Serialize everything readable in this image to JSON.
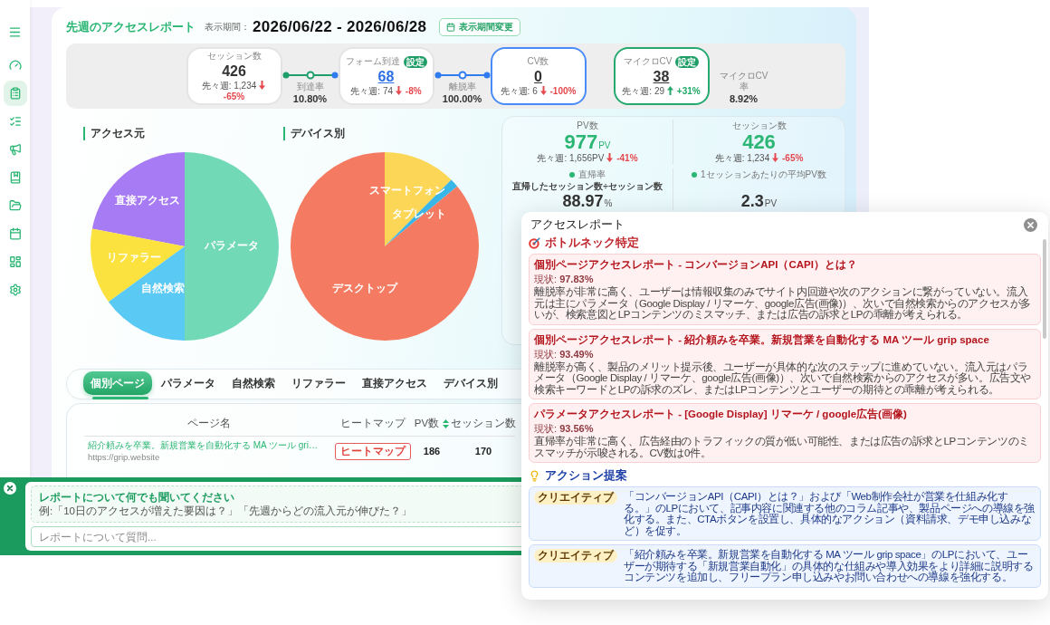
{
  "sidebar": {
    "items": [
      {
        "kind": "gauge",
        "selected": false
      },
      {
        "kind": "clipboard",
        "selected": true
      },
      {
        "kind": "checklist",
        "selected": false
      },
      {
        "kind": "megaphone",
        "selected": false
      },
      {
        "kind": "book",
        "selected": false
      },
      {
        "kind": "folder",
        "selected": false
      },
      {
        "kind": "calendar",
        "selected": false
      },
      {
        "kind": "layout",
        "selected": false
      },
      {
        "kind": "settings",
        "selected": false
      }
    ]
  },
  "header": {
    "title": "先週のアクセスレポート",
    "period_label": "表示期間：",
    "period": "2026/06/22 - 2026/06/28",
    "change_button": "表示期間変更"
  },
  "funnel": {
    "items": [
      {
        "kind": "card",
        "label": "セッション数",
        "color": "#e4e4e4",
        "value": {
          "text": "426",
          "underlined": false,
          "color": "#333333"
        },
        "comparison": {
          "kind": "down",
          "previous": "先々週: 1,234",
          "change": "-65%",
          "color": "#e5484d"
        }
      },
      {
        "kind": "connector",
        "label": "到達率",
        "value": "10.80%",
        "color": "#1e9e6a",
        "end_dot": {
          "color": "#2f7bf0"
        }
      },
      {
        "kind": "card",
        "label": "フォーム到達",
        "badge": "設定",
        "color": "#e4e4e4",
        "value": {
          "text": "68",
          "underlined": true,
          "color": "#2f6fe6"
        },
        "comparison": {
          "kind": "down",
          "previous": "先々週: 74",
          "change": "-8%",
          "color": "#e5484d"
        }
      },
      {
        "kind": "connector",
        "label": "離脱率",
        "value": "100.00%",
        "color": "#2f7bf0",
        "end_dot": {
          "color": "#2f7bf0"
        }
      },
      {
        "kind": "card",
        "label": "CV数",
        "color": "#4a8cf7",
        "value": {
          "text": "0",
          "underlined": true,
          "color": "#333333"
        },
        "comparison": {
          "kind": "down",
          "previous": "先々週: 6",
          "change": "-100%",
          "color": "#e5484d"
        }
      },
      {
        "kind": "card",
        "label": "マイクロCV",
        "badge": "設定",
        "color": "#26a96f",
        "value": {
          "text": "38",
          "underlined": true,
          "color": "#333333"
        },
        "comparison": {
          "kind": "up",
          "previous": "先々週: 29",
          "change": "+31%",
          "color": "#22a867"
        }
      },
      {
        "kind": "rate",
        "label": "マイクロCV率",
        "value": "8.92%"
      }
    ]
  },
  "charts": [
    {
      "title": "アクセス元",
      "slices": [
        {
          "label": "直接アクセス",
          "color": "#a77bf3"
        },
        {
          "label": "パラメータ",
          "color": "#72d9b6"
        },
        {
          "label": "リファラー",
          "color": "#fbe23f"
        },
        {
          "label": "自然検索",
          "color": "#5ac9f3"
        }
      ]
    },
    {
      "title": "デバイス別",
      "slices": [
        {
          "label": "スマートフォン",
          "color": "#fcd757"
        },
        {
          "label": "タブレット",
          "color": "#38b6e8"
        },
        {
          "label": "デスクトップ",
          "color": "#f47b62"
        }
      ]
    }
  ],
  "stats": {
    "metrics": [
      {
        "kind": "total",
        "label": "PV数",
        "value": "977",
        "unit": "PV",
        "comparison": {
          "kind": "down",
          "previous": "先々週: 1,656PV",
          "change": "-41%",
          "color": "#e5484d"
        }
      },
      {
        "kind": "total",
        "label": "セッション数",
        "value": "426",
        "comparison": {
          "kind": "down",
          "previous": "先々週: 1,234",
          "change": "-65%",
          "color": "#e5484d"
        }
      },
      {
        "kind": "ratio",
        "label": "直帰率",
        "note": "直帰したセッション数÷セッション数",
        "value": "88.97",
        "unit": "%"
      },
      {
        "kind": "ratio",
        "label": "1セッションあたりの平均PV数",
        "value": "2.3",
        "unit": "PV"
      }
    ]
  },
  "tabs": [
    {
      "label": "個別ページ",
      "selected": true
    },
    {
      "label": "パラメータ",
      "selected": false
    },
    {
      "label": "自然検索",
      "selected": false
    },
    {
      "label": "リファラー",
      "selected": false
    },
    {
      "label": "直接アクセス",
      "selected": false
    },
    {
      "label": "デバイス別",
      "selected": false
    }
  ],
  "table": {
    "columns": [
      {
        "label": "ページ名",
        "sortable": false
      },
      {
        "label": "ヒートマップ",
        "sortable": false
      },
      {
        "label": "PV数",
        "sortable": true
      },
      {
        "label": "セッション数",
        "sortable": false
      }
    ],
    "rows": [
      {
        "title": "紹介頼みを卒業。新規営業を自動化する MA ツール gri…",
        "url": "https://grip.website",
        "heatmap": "ヒートマップ",
        "pv": "186",
        "sessions": "170"
      }
    ]
  },
  "chat": {
    "title": "レポートについて何でも聞いてください",
    "example": "例:「10日のアクセスが増えた要因は？」「先週からどの流入元が伸びた？」",
    "placeholder": "レポートについて質問..."
  },
  "report_dialog": {
    "title": "アクセスレポート",
    "sections": [
      {
        "kind": "bottleneck",
        "heading": "ボトルネック特定",
        "items": [
          {
            "title": "個別ページアクセスレポート - コンバージョンAPI（CAPI）とは？",
            "status": "現状: **97.83%**",
            "body": "離脱率が非常に高く、ユーザーは情報収集のみでサイト内回遊や次のアクションに繋がっていない。流入元は主にパラメータ（Google Display / リマーケ、google広告(画像)）、次いで自然検索からのアクセスが多いが、検索意図とLPコンテンツのミスマッチ、または広告の訴求とLPの乖離が考えられる。"
          },
          {
            "title": "個別ページアクセスレポート - 紹介頼みを卒業。新規営業を自動化する MA ツール grip space",
            "status": "現状: **93.49%**",
            "body": "離脱率が高く、製品のメリット提示後、ユーザーが具体的な次のステップに進めていない。流入元はパラメータ（Google Display / リマーケ、google広告(画像)）、次いで自然検索からのアクセスが多い。広告文や検索キーワードとLPの訴求のズレ、またはLPコンテンツとユーザーの期待との乖離が考えられる。"
          },
          {
            "title": "パラメータアクセスレポート - [Google Display] リマーケ / google広告(画像)",
            "status": "現状: **93.56%**",
            "body": "直帰率が非常に高く、広告経由のトラフィックの質が低い可能性、または広告の訴求とLPコンテンツのミスマッチが示唆される。CV数は0件。"
          }
        ]
      },
      {
        "kind": "action",
        "heading": "アクション提案",
        "items": [
          {
            "tag": "クリエイティブ",
            "body": "「コンバージョンAPI（CAPI）とは？」および「Web制作会社が営業を仕組み化する。」のLPにおいて、記事内容に関連する他のコラム記事や、製品ページへの導線を強化する。また、CTAボタンを設置し、具体的なアクション（資料請求、デモ申し込みなど）を促す。"
          },
          {
            "tag": "クリエイティブ",
            "body": "「紹介頼みを卒業。新規営業を自動化する MA ツール grip space」のLPにおいて、ユーザーが期待する「新規営業自動化」の具体的な仕組みや導入効果をより詳細に説明するコンテンツを追加し、フリープラン申し込みやお問い合わせへの導線を強化する。"
          }
        ]
      }
    ]
  }
}
